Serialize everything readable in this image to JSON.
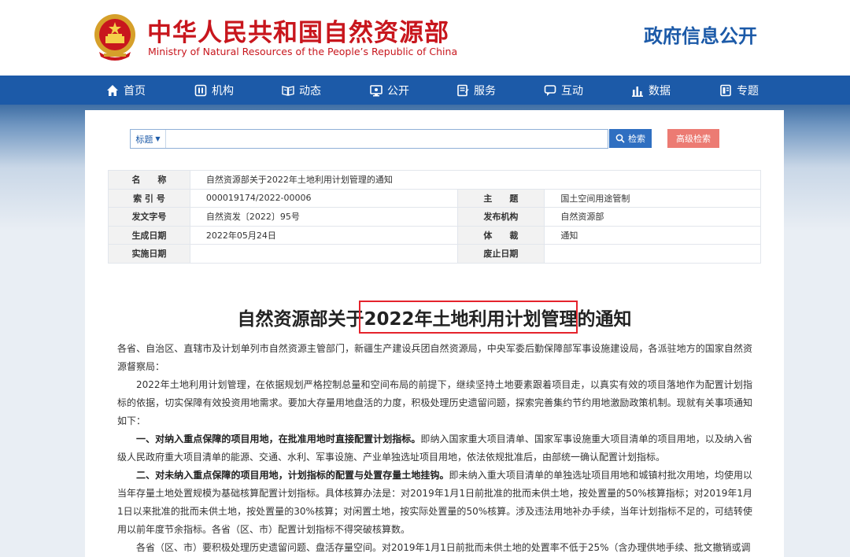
{
  "header": {
    "title_cn": "中华人民共和国自然资源部",
    "title_en": "Ministry of Natural Resources of the People’s Republic of China",
    "gov_info": "政府信息公开"
  },
  "colors": {
    "brand_red": "#c8161d",
    "nav_blue": "#1c5aa8",
    "search_blue": "#2f6fc1",
    "adv_red": "#ec7b73",
    "highlight": "#e5232c"
  },
  "nav": {
    "items": [
      {
        "label": "首页",
        "icon": "home-icon"
      },
      {
        "label": "机构",
        "icon": "institution-icon"
      },
      {
        "label": "动态",
        "icon": "news-icon"
      },
      {
        "label": "公开",
        "icon": "disclosure-icon"
      },
      {
        "label": "服务",
        "icon": "service-icon"
      },
      {
        "label": "互动",
        "icon": "chat-icon"
      },
      {
        "label": "数据",
        "icon": "data-icon"
      },
      {
        "label": "专题",
        "icon": "topic-icon"
      }
    ]
  },
  "search": {
    "type_label": "标题",
    "value": "",
    "button_label": "检索",
    "advanced_label": "高级检索"
  },
  "meta": {
    "name_label": "名　　称",
    "name_value": "自然资源部关于2022年土地利用计划管理的通知",
    "index_label": "索 引 号",
    "index_value": "000019174/2022-00006",
    "subject_label": "主　　题",
    "subject_value": "国土空间用途管制",
    "docno_label": "发文字号",
    "docno_value": "自然资发〔2022〕95号",
    "issuer_label": "发布机构",
    "issuer_value": "自然资源部",
    "date_label": "生成日期",
    "date_value": "2022年05月24日",
    "genre_label": "体　　裁",
    "genre_value": "通知",
    "effective_label": "实施日期",
    "effective_value": "",
    "repeal_label": "废止日期",
    "repeal_value": ""
  },
  "doc": {
    "title": "自然资源部关于2022年土地利用计划管理的通知",
    "addressee": "各省、自治区、直辖市及计划单列市自然资源主管部门，新疆生产建设兵团自然资源局，中央军委后勤保障部军事设施建设局，各派驻地方的国家自然资源督察局：",
    "intro": "2022年土地利用计划管理，在依据规划严格控制总量和空间布局的前提下，继续坚持土地要素跟着项目走，以真实有效的项目落地作为配置计划指标的依据，切实保障有效投资用地需求。要加大存量用地盘活的力度，积极处理历史遗留问题，探索完善集约节约用地激励政策机制。现就有关事项通知如下：",
    "s1_head": "一、对纳入重点保障的项目用地，在批准用地时直接配置计划指标。",
    "s1_body": "即纳入国家重大项目清单、国家军事设施重大项目清单的项目用地，以及纳入省级人民政府重大项目清单的能源、交通、水利、军事设施、产业单独选址项目用地，依法依规批准后，由部统一确认配置计划指标。",
    "s2_head": "二、对未纳入重点保障的项目用地，计划指标的配置与处置存量土地挂钩。",
    "s2_body": "即未纳入重大项目清单的单独选址项目用地和城镇村批次用地，均使用以当年存量土地处置规模为基础核算配置计划指标。具体核算办法是：对2019年1月1日前批准的批而未供土地，按处置量的50%核算指标；对2019年1月1日以来批准的批而未供土地，按处置量的30%核算；对闲置土地，按实际处置量的50%核算。涉及违法用地补办手续，当年计划指标不足的，可结转使用以前年度节余指标。各省（区、市）配置计划指标不得突破核算数。",
    "s3": "各省（区、市）要积极处理历史遗留问题、盘活存量空间。对2019年1月1日前批而未供土地的处置率不低于25%（含办理供地手续、批文撤销或调"
  }
}
